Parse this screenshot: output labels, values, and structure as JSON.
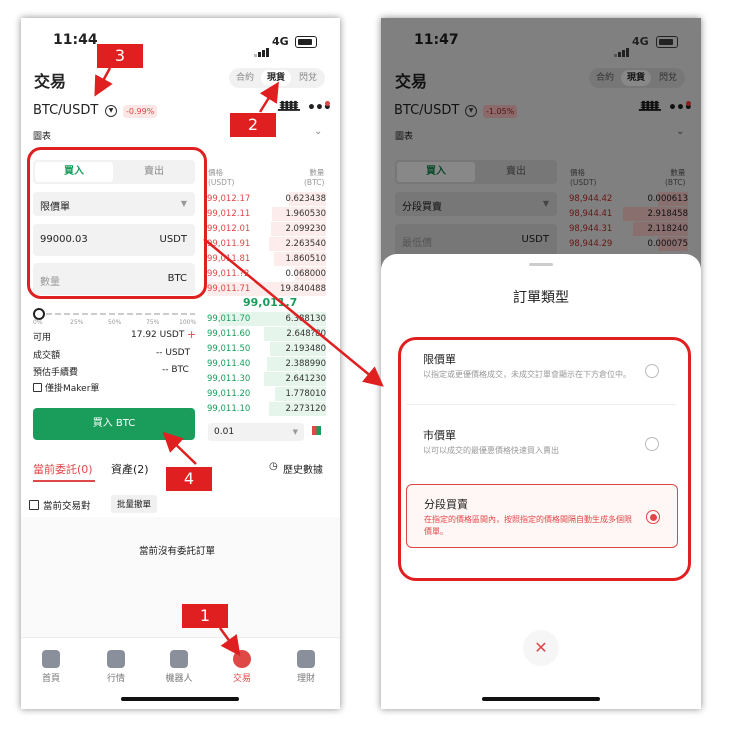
{
  "left": {
    "status": {
      "time": "11:44",
      "network": "4G"
    },
    "title": "交易",
    "mode_tabs": [
      "合約",
      "現貨",
      "閃兌"
    ],
    "pair": "BTC/USDT",
    "change": "-0.99%",
    "chart_label": "圖表",
    "side_tabs": {
      "buy": "買入",
      "sell": "賣出"
    },
    "order_type": "限價單",
    "price_value": "99000.03",
    "price_unit": "USDT",
    "qty_placeholder": "數量",
    "qty_unit": "BTC",
    "slider_ticks": [
      "0%",
      "25%",
      "50%",
      "75%",
      "100%"
    ],
    "available_label": "可用",
    "available_value": "17.92 USDT",
    "amount_label": "成交額",
    "amount_value": "-- USDT",
    "fee_label": "預估手續費",
    "fee_value": "-- BTC",
    "maker_label": "僅掛Maker單",
    "buy_button": "買入 BTC",
    "orderbook": {
      "price_header": "價格\n(USDT)",
      "qty_header": "數量\n(BTC)",
      "asks": [
        [
          "99,012.17",
          "0.623438"
        ],
        [
          "99,012.11",
          "1.960530"
        ],
        [
          "99,012.01",
          "2.099230"
        ],
        [
          "99,011.91",
          "2.263540"
        ],
        [
          "99,011.81",
          "1.860510"
        ],
        [
          "99,011.?2",
          "0.068000"
        ],
        [
          "99,011.71",
          "19.840488"
        ]
      ],
      "mid": "99,011.7",
      "bids": [
        [
          "99,011.70",
          "6.388130"
        ],
        [
          "99,011.60",
          "2.648?80"
        ],
        [
          "99,011.50",
          "2.193480"
        ],
        [
          "99,011.40",
          "2.388990"
        ],
        [
          "99,011.30",
          "2.641230"
        ],
        [
          "99,011.20",
          "1.778010"
        ],
        [
          "99,011.10",
          "2.273120"
        ]
      ],
      "depth": "0.01"
    },
    "tabs": {
      "current": "當前委託(0)",
      "assets": "資產(2)",
      "history": "歷史數據"
    },
    "filter_label": "當前交易對",
    "batch_cancel": "批量撤單",
    "empty_text": "當前沒有委託訂單",
    "bottom_nav": [
      "首頁",
      "行情",
      "機器人",
      "交易",
      "理財"
    ],
    "annotations": [
      "1",
      "2",
      "3",
      "4"
    ]
  },
  "right": {
    "status": {
      "time": "11:47",
      "network": "4G"
    },
    "title": "交易",
    "mode_tabs": [
      "合約",
      "現貨",
      "閃兌"
    ],
    "pair": "BTC/USDT",
    "change": "-1.05%",
    "chart_label": "圖表",
    "side_tabs": {
      "buy": "買入",
      "sell": "賣出"
    },
    "order_type": "分段買賣",
    "field_label": "最低價",
    "field_unit": "USDT",
    "orderbook": {
      "price_header": "價格\n(USDT)",
      "qty_header": "數量\n(BTC)",
      "asks": [
        [
          "98,944.42",
          "0.000613"
        ],
        [
          "98,944.41",
          "2.918458"
        ],
        [
          "98,944.31",
          "2.118240"
        ],
        [
          "98,944.29",
          "0.000075"
        ]
      ]
    },
    "sheet": {
      "title": "訂單類型",
      "options": [
        {
          "title": "限價單",
          "desc": "以指定或更優價格成交，未成交訂單會顯示在下方倉位中。",
          "selected": false
        },
        {
          "title": "市價單",
          "desc": "以可以成交的最優惠價格快速買入賣出",
          "selected": false
        },
        {
          "title": "分段買賣",
          "desc": "在指定的價格區間內，按照指定的價格間隔自動生成多個限價單。",
          "selected": true
        }
      ],
      "close": "✕"
    }
  },
  "colors": {
    "accent_green": "#1a9c5b",
    "accent_red": "#e04848",
    "annotation_red": "#e02020"
  }
}
